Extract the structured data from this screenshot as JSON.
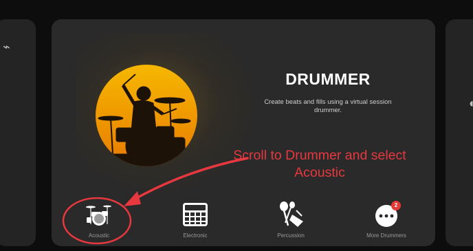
{
  "card": {
    "title": "DRUMMER",
    "description": "Create beats and fills using a virtual session drummer."
  },
  "annotation": {
    "text": "Scroll to Drummer and select Acoustic",
    "color": "#e8383f"
  },
  "options": [
    {
      "label": "Acoustic",
      "icon": "acoustic-drum-kit-icon"
    },
    {
      "label": "Electronic",
      "icon": "drum-machine-icon"
    },
    {
      "label": "Percussion",
      "icon": "percussion-icon"
    },
    {
      "label": "More Drummers",
      "icon": "more-icon",
      "badge": "2"
    }
  ],
  "colors": {
    "art_gradient_top": "#f6b800",
    "art_gradient_bottom": "#e87a00",
    "badge": "#e53935"
  }
}
